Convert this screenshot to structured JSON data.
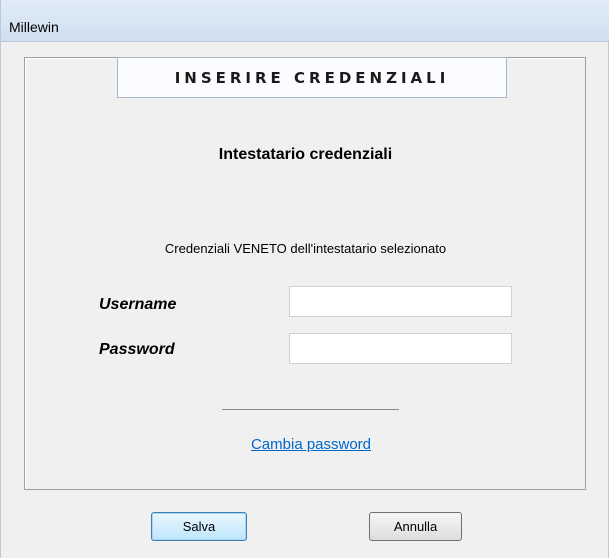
{
  "window": {
    "title": "Millewin"
  },
  "dialog": {
    "header": "INSERIRE CREDENZIALI",
    "subtitle": "Intestatario credenziali",
    "info": "Credenziali VENETO dell'intestatario selezionato",
    "username": {
      "label": "Username",
      "value": "",
      "placeholder": ""
    },
    "password": {
      "label": "Password",
      "value": "",
      "placeholder": ""
    },
    "change_password_link": "Cambia password"
  },
  "buttons": {
    "save_label": "Salva",
    "cancel_label": "Annulla"
  },
  "colors": {
    "link": "#0066cc",
    "titlebar": "#d7e4f2",
    "background": "#f0f0f0"
  }
}
